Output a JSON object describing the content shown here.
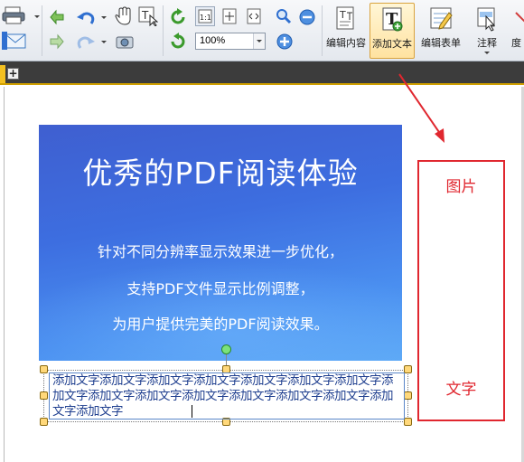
{
  "toolbar": {
    "zoom_value": "100%",
    "big_buttons": [
      {
        "label": "编辑内容"
      },
      {
        "label": "添加文本"
      },
      {
        "label": "编辑表单"
      },
      {
        "label": "注释"
      },
      {
        "label": "度"
      }
    ]
  },
  "banner": {
    "title": "优秀的PDF阅读体验",
    "lines": [
      "针对不同分辨率显示效果进一步优化，",
      "支持PDF文件显示比例调整，",
      "为用户提供完美的PDF阅读效果。"
    ]
  },
  "added_text": "添加文字添加文字添加文字添加文字添加文字添加文字添加文字添加文字添加文字添加文字添加文字添加文字添加文字添加文字添加文字添加文字",
  "annotation": {
    "image_label": "图片",
    "text_label": "文字",
    "color": "#e0272f"
  },
  "colors": {
    "accent": "#f3c021",
    "banner": "#3d6ee0"
  }
}
